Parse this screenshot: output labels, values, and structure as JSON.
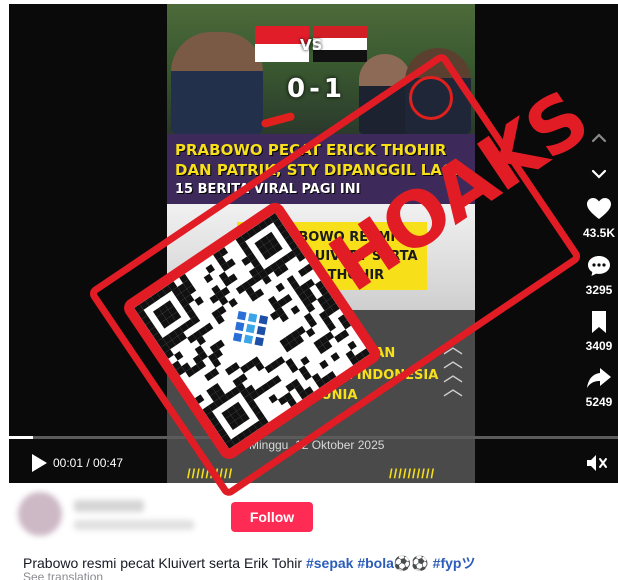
{
  "video": {
    "match": {
      "vs": "VS",
      "score": "0-1"
    },
    "headline_lines": [
      "PRABOWO PECAT ERICK THOHIR",
      "DAN PATRIK, STY DIPANGGIL LAGI",
      "15 BERITA VIRAL PAGI INI"
    ],
    "mid_lines": [
      "PRABOWO RESMI",
      "PECAT KLUIVERT SERTA",
      "ERICK THOHIR"
    ],
    "bottom_lines": [
      "TELAH GAGALKAN",
      "MPIAN SAYA INDONESIA",
      "PIALA DUNIA"
    ],
    "date": "Minggu, 12 Oktober 2025",
    "slashes": "//////////",
    "stamp_word": "HOAKS"
  },
  "player": {
    "time": "00:01 / 00:47",
    "progress": 0.04,
    "icons": {
      "play": "play-icon",
      "mute": "mute-icon",
      "up": "chevron-up-icon",
      "down": "chevron-down-icon"
    }
  },
  "actions": {
    "like": {
      "icon": "heart-icon",
      "count": "43.5K"
    },
    "comment": {
      "icon": "comment-icon",
      "count": "3295"
    },
    "save": {
      "icon": "bookmark-icon",
      "count": "3409"
    },
    "share": {
      "icon": "share-icon",
      "count": "5249"
    }
  },
  "post": {
    "follow_label": "Follow",
    "caption_text": "Prabowo resmi pecat Kluivert serta Erik Tohir",
    "hashtags": [
      "#sepak",
      "#bola⚽⚽",
      "#fypツ"
    ],
    "see_translation": "See translation"
  },
  "colors": {
    "accent": "#fe2c55",
    "hashtag": "#2b5db9",
    "stamp": "#e11c24",
    "headline": "#f7e01a"
  }
}
